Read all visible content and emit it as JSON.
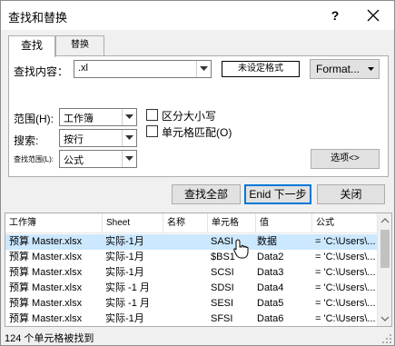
{
  "window": {
    "title": "查找和替换",
    "help": "?"
  },
  "tabs": [
    {
      "label": "查找"
    },
    {
      "label": "替换"
    }
  ],
  "find": {
    "find_what_label": "查找内容：",
    "find_what_value": ".xl",
    "preview": "未设定格式",
    "format_button": "Format...",
    "within_label": "范围(H):",
    "within_value": "工作簿",
    "search_label": "搜索:",
    "search_value": "按行",
    "lookin_label": "查找范围(L):",
    "lookin_value": "公式",
    "match_case_label": "区分大小写",
    "match_entire_label": "单元格匹配(O)",
    "options_button": "选项<>"
  },
  "actions": {
    "find_all": "查找全部",
    "find_next": "Enid 下一步",
    "close": "关闭"
  },
  "results": {
    "columns": [
      "工作簿",
      "Sheet",
      "名称",
      "单元格",
      "值",
      "公式"
    ],
    "rows": [
      {
        "book": "预算 Master.xlsx",
        "sheet": "实际-1月",
        "name": "",
        "cell": "SASI",
        "value": "数据",
        "formula": "= 'C:\\Users\\..."
      },
      {
        "book": "预算 Master.xlsx",
        "sheet": "实际-1月",
        "name": "",
        "cell": "$BS1",
        "value": "Data2",
        "formula": "= 'C:\\Users\\..."
      },
      {
        "book": "预算 Master.xlsx",
        "sheet": "实际-1月",
        "name": "",
        "cell": "SCSI",
        "value": "Data3",
        "formula": "= 'C:\\Users\\..."
      },
      {
        "book": "预算 Master.xlsx",
        "sheet": "实际 -1 月",
        "name": "",
        "cell": "SDSI",
        "value": "Data4",
        "formula": "= 'C:\\Users\\..."
      },
      {
        "book": "预算 Master.xlsx",
        "sheet": "实际 -1 月",
        "name": "",
        "cell": "SESI",
        "value": "Data5",
        "formula": "= 'C:\\Users\\..."
      },
      {
        "book": "预算 Master.xlsx",
        "sheet": "实际-1月",
        "name": "",
        "cell": "SFSI",
        "value": "Data6",
        "formula": "= 'C:\\Users\\..."
      }
    ]
  },
  "status": "124 个单元格被找到",
  "colors": {
    "accent": "#0078d7",
    "selection": "#cce8ff"
  }
}
